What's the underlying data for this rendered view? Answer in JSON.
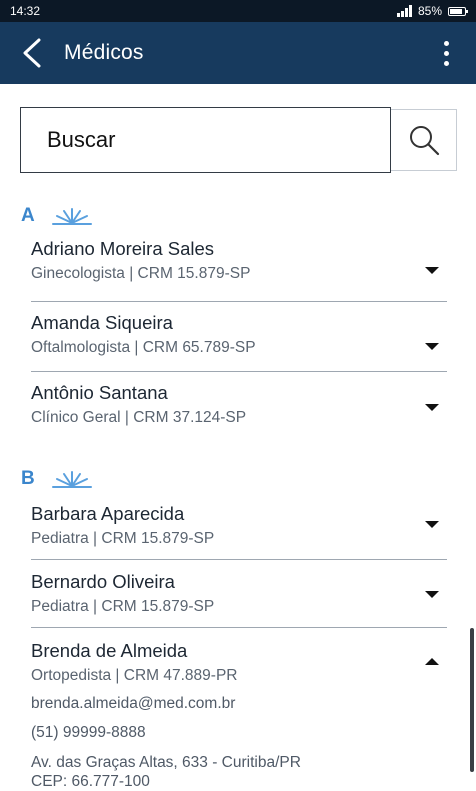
{
  "status_bar": {
    "time": "14:32",
    "battery": "85%",
    "battery_level": 0.85
  },
  "app_bar": {
    "title": "Médicos"
  },
  "search": {
    "placeholder": "Buscar",
    "value": ""
  },
  "sections": [
    {
      "letter": "A",
      "doctors": [
        {
          "name": "Adriano Moreira Sales",
          "specialty_crm": "Ginecologista | CRM 15.879-SP"
        },
        {
          "name": "Amanda Siqueira",
          "specialty_crm": "Oftalmologista | CRM 65.789-SP"
        },
        {
          "name": "Antônio Santana",
          "specialty_crm": "Clínico Geral | CRM 37.124-SP"
        }
      ]
    },
    {
      "letter": "B",
      "doctors": [
        {
          "name": "Barbara Aparecida",
          "specialty_crm": "Pediatra | CRM 15.879-SP"
        },
        {
          "name": "Bernardo Oliveira",
          "specialty_crm": "Pediatra | CRM 15.879-SP"
        },
        {
          "name": "Brenda de Almeida",
          "specialty_crm": "Ortopedista | CRM 47.889-PR",
          "email": "brenda.almeida@med.com.br",
          "phone": "(51) 99999-8888",
          "address": "Av. das Graças Altas, 633 - Curitiba/PR",
          "cep": "CEP: 66.777-100"
        }
      ]
    }
  ],
  "colors": {
    "app_bar": "#173a5e",
    "status_bar": "#0c1826",
    "accent": "#3b86cc"
  }
}
